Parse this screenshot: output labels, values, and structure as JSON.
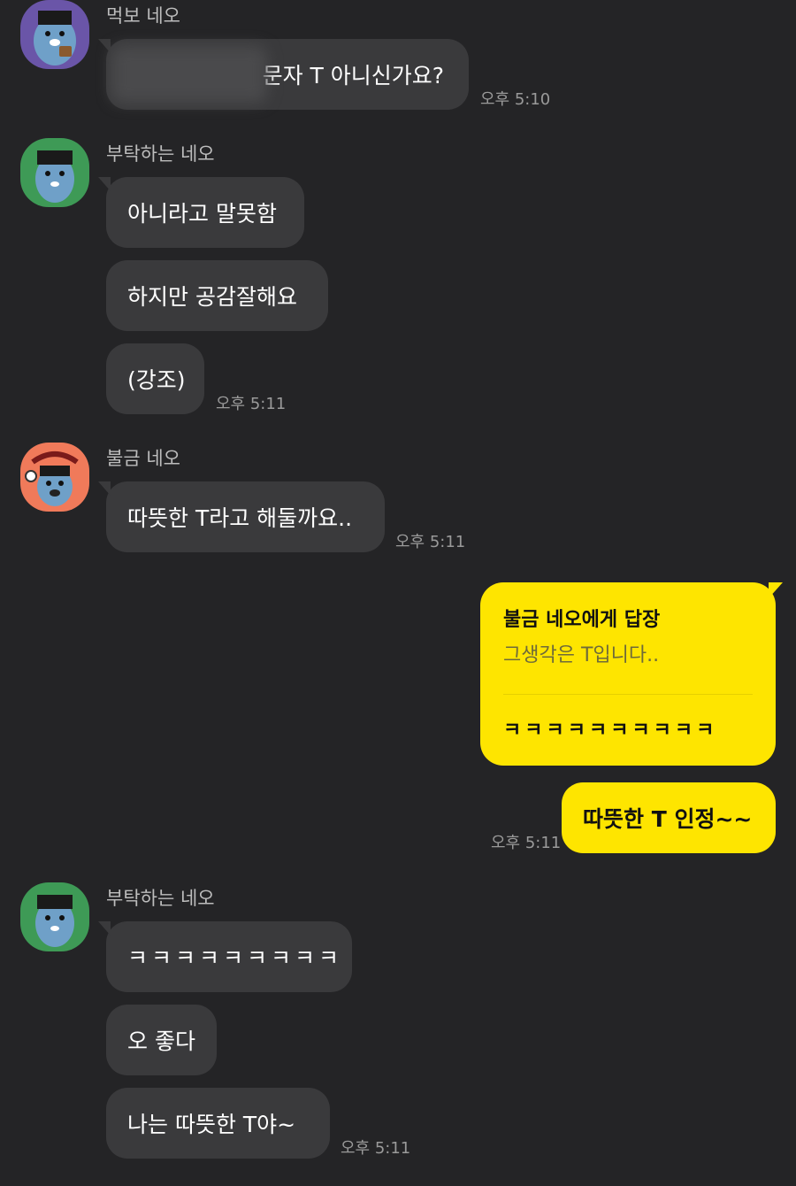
{
  "messages": {
    "m1": {
      "sender": "먹보 네오",
      "text": "문자 T 아니신가요?",
      "time": "오후 5:10"
    },
    "m2": {
      "sender": "부탁하는 네오",
      "lines": [
        "아니라고 말못함",
        "하지만 공감잘해요",
        "(강조)"
      ],
      "time": "오후 5:11"
    },
    "m3": {
      "sender": "불금 네오",
      "text": "따뜻한 T라고 해둘까요..",
      "time": "오후 5:11"
    },
    "reply": {
      "header": "불금 네오에게 답장",
      "quoted": "그생각은 T입니다..",
      "text": "ㅋㅋㅋㅋㅋㅋㅋㅋㅋㅋ"
    },
    "mine": {
      "text": "따뜻한 T 인정~~",
      "time": "오후 5:11"
    },
    "m4": {
      "sender": "부탁하는 네오",
      "lines": [
        "ㅋㅋㅋㅋㅋㅋㅋㅋㅋ",
        "오 좋다",
        "나는 따뜻한 T야~"
      ],
      "time": "오후 5:11"
    }
  },
  "avatars": [
    "neo-eating-icon",
    "neo-pleading-icon",
    "neo-friday-icon",
    "neo-pleading-icon"
  ],
  "colors": {
    "background": "#242426",
    "bubble": "#3a3a3c",
    "my_bubble": "#fee500"
  }
}
